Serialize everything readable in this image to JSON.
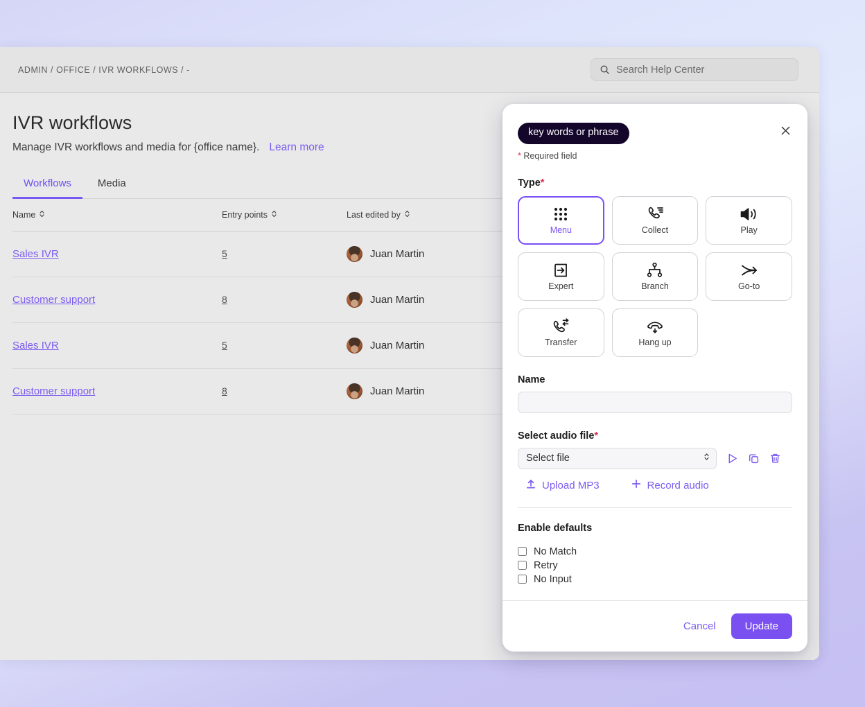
{
  "app": {
    "breadcrumb": "ADMIN / OFFICE / IVR WORKFLOWS / -",
    "search": {
      "placeholder": "Search Help Center",
      "icon": "search-icon"
    }
  },
  "page": {
    "title": "IVR workflows",
    "subtitle": "Manage IVR workflows and media for {office name}.",
    "learn_more": "Learn more",
    "tabs": [
      {
        "label": "Workflows",
        "active": true
      },
      {
        "label": "Media",
        "active": false
      }
    ]
  },
  "table": {
    "columns": [
      "Name",
      "Entry points",
      "Last edited by"
    ],
    "rows": [
      {
        "name": "Sales IVR",
        "entry_points": "5",
        "editor": "Juan Martin"
      },
      {
        "name": "Customer support",
        "entry_points": "8",
        "editor": "Juan Martin"
      },
      {
        "name": "Sales IVR",
        "entry_points": "5",
        "editor": "Juan Martin"
      },
      {
        "name": "Customer support",
        "entry_points": "8",
        "editor": "Juan Martin"
      }
    ]
  },
  "modal": {
    "chip": "key words or phrase",
    "close_icon": "close-icon",
    "required_note": "Required field",
    "required_star": "*",
    "type_label": "Type",
    "types": [
      {
        "label": "Menu",
        "icon": "keypad-icon",
        "selected": true
      },
      {
        "label": "Collect",
        "icon": "phone-list-icon",
        "selected": false
      },
      {
        "label": "Play",
        "icon": "speaker-icon",
        "selected": false
      },
      {
        "label": "Expert",
        "icon": "login-arrow-icon",
        "selected": false
      },
      {
        "label": "Branch",
        "icon": "branch-tree-icon",
        "selected": false
      },
      {
        "label": "Go-to",
        "icon": "goto-arrow-icon",
        "selected": false
      },
      {
        "label": "Transfer",
        "icon": "phone-transfer-icon",
        "selected": false
      },
      {
        "label": "Hang up",
        "icon": "hangup-icon",
        "selected": false
      }
    ],
    "name_label": "Name",
    "name_value": "",
    "name_placeholder": "",
    "audio_label": "Select audio file",
    "audio_selected": "Select file",
    "audio_options": [
      "Select file"
    ],
    "upload_mp3": "Upload MP3",
    "record_audio": "Record audio",
    "defaults_title": "Enable defaults",
    "defaults": [
      {
        "label": "No Match",
        "checked": false
      },
      {
        "label": "Retry",
        "checked": false
      },
      {
        "label": "No Input",
        "checked": false
      }
    ],
    "cancel": "Cancel",
    "update": "Update"
  },
  "colors": {
    "accent": "#7a50f0",
    "link": "#7c5cf0",
    "chip_bg": "#14062b",
    "required": "#e02d4d"
  }
}
